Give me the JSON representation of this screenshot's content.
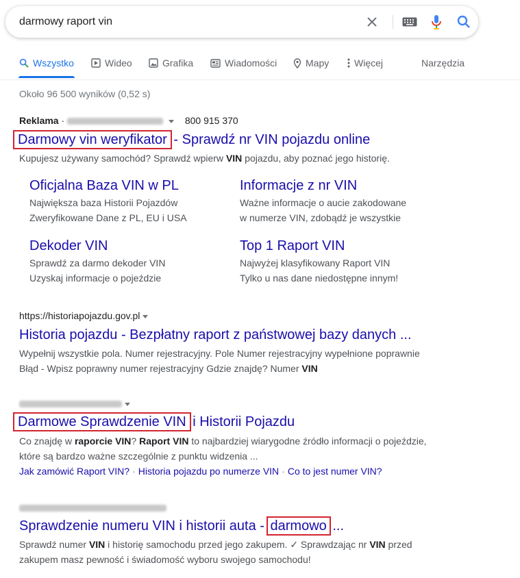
{
  "search": {
    "query": "darmowy raport vin"
  },
  "tabs": [
    {
      "label": "Wszystko",
      "icon": "search-icon"
    },
    {
      "label": "Wideo",
      "icon": "video-icon"
    },
    {
      "label": "Grafika",
      "icon": "image-icon"
    },
    {
      "label": "Wiadomości",
      "icon": "news-icon"
    },
    {
      "label": "Mapy",
      "icon": "map-pin-icon"
    },
    {
      "label": "Więcej",
      "icon": "more-vert-icon"
    }
  ],
  "tools_label": "Narzędzia",
  "stats": "Około 96 500 wyników (0,52 s)",
  "ad": {
    "label": "Reklama",
    "phone": "800 915 370",
    "title_highlight": "Darmowy vin weryfikator",
    "title_rest": "- Sprawdź nr VIN pojazdu online",
    "snippet_before": "Kupujesz używany samochód? Sprawdź wpierw ",
    "snippet_bold": "VIN",
    "snippet_after": " pojazdu, aby poznać jego historię.",
    "sitelinks": [
      {
        "title": "Oficjalna Baza VIN w PL",
        "line1": "Największa baza Historii Pojazdów",
        "line2": "Zweryfikowane Dane z PL, EU i USA"
      },
      {
        "title": "Informacje z nr VIN",
        "line1": "Ważne informacje o aucie zakodowane",
        "line2": "w numerze VIN, zdobądź je wszystkie"
      },
      {
        "title": "Dekoder VIN",
        "line1": "Sprawdź za darmo dekoder VIN",
        "line2": "Uzyskaj informacje o pojeździe"
      },
      {
        "title": "Top 1 Raport VIN",
        "line1": "Najwyżej klasyfikowany Raport VIN",
        "line2": "Tylko u nas dane niedostępne innym!"
      }
    ]
  },
  "results": [
    {
      "url": "https://historiapojazdu.gov.pl",
      "title": "Historia pojazdu - Bezpłatny raport z państwowej bazy danych ...",
      "line1": "Wypełnij wszystkie pola. Numer rejestracyjny. Pole Numer rejestracyjny wypełnione poprawnie",
      "line2_before": "Błąd - Wpisz poprawny numer rejestracyjny Gdzie znajdę? Numer ",
      "line2_bold": "VIN"
    },
    {
      "title_highlight": "Darmowe Sprawdzenie VIN",
      "title_rest": "i Historii Pojazdu",
      "l1_a": "Co znajdę w ",
      "l1_b": "raporcie VIN",
      "l1_c": "? ",
      "l1_d": "Raport VIN",
      "l1_e": " to najbardziej wiarygodne źródło informacji o pojeździe,",
      "line2": "które są bardzo ważne szczególnie z punktu widzenia ...",
      "links": [
        "Jak zamówić Raport VIN?",
        "Historia pojazdu po numerze VIN",
        "Co to jest numer VIN?"
      ]
    },
    {
      "title_before": "Sprawdzenie numeru VIN i historii auta -",
      "title_highlight": "darmowo",
      "title_after": "...",
      "l1_a": "Sprawdź numer ",
      "l1_b": "VIN",
      "l1_c": " i historię samochodu przed jego zakupem. ✓ Sprawdzając nr ",
      "l1_d": "VIN",
      "l1_e": " przed",
      "line2": "zakupem masz pewność i świadomość wyboru swojego samochodu!"
    }
  ],
  "colors": {
    "link": "#1a0dab",
    "accent": "#1a73e8",
    "highlight_box": "#d3232f"
  }
}
